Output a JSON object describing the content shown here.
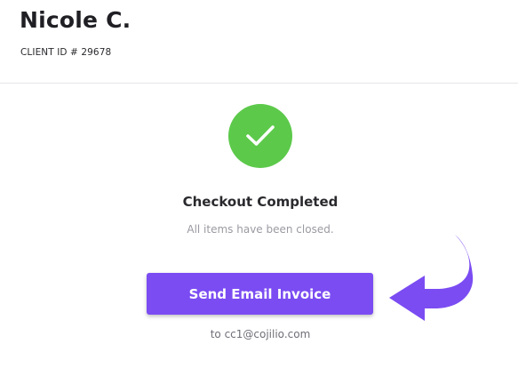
{
  "client": {
    "name": "Nicole C.",
    "id_label": "CLIENT ID # 29678"
  },
  "status": {
    "icon": "check-icon",
    "title": "Checkout Completed",
    "subtitle": "All items have been closed."
  },
  "actions": {
    "send_invoice_label": "Send Email Invoice",
    "recipient_text": "to cc1@cojilio.com"
  },
  "colors": {
    "success": "#5cc94a",
    "accent": "#7b4cf2",
    "callout_arrow": "#7b4cf2"
  },
  "annotation": {
    "icon": "curved-arrow-icon"
  }
}
